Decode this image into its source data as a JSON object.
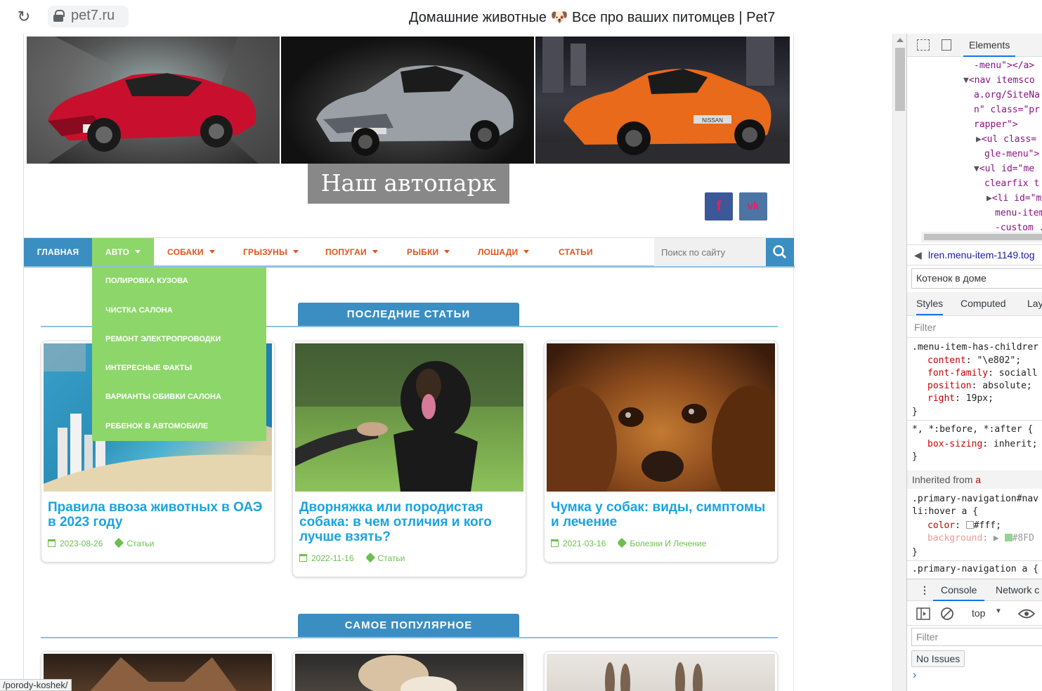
{
  "browser": {
    "url": "pet7.ru",
    "title": "Домашние животные 🐶 Все про ваших питомцев | Pet7"
  },
  "site": {
    "title": "Наш автопарк",
    "nav": {
      "home": "Главная",
      "auto": "Авто",
      "dogs": "Собаки",
      "rodents": "Грызуны",
      "parrots": "Попугаи",
      "fish": "Рыбки",
      "horses": "Лошади",
      "articles": "Статьи",
      "search_placeholder": "Поиск по сайту"
    },
    "dropdown": [
      "Полировка кузова",
      "Чистка салона",
      "Ремонт электропроводки",
      "Интересные факты",
      "Варианты обивки салона",
      "Ребенок в автомобиле"
    ],
    "sections": {
      "latest": "Последние статьи",
      "popular": "Самое популярное"
    },
    "cards": [
      {
        "title": "Правила ввоза животных в ОАЭ в 2023 году",
        "date": "2023-08-26",
        "category": "Статьи"
      },
      {
        "title": "Дворняжка или породистая собака: в чем отличия и кого лучше взять?",
        "date": "2022-11-16",
        "category": "Статьи"
      },
      {
        "title": "Чумка у собак: виды, симптомы и лечение",
        "date": "2021-03-16",
        "category": "Болезни И Лечение"
      }
    ],
    "social": {
      "fb": "f",
      "vk": "vk"
    },
    "status_link": "/porody-koshek/",
    "car_plate": "NISSAN"
  },
  "devtools": {
    "tab_elements": "Elements",
    "dom_lines": [
      "-menu\"></a>",
      "<nav itemsco",
      "a.org/SiteNa",
      "n\" class=\"pr",
      "rapper\">",
      "<ul class=",
      "gle-menu\">",
      "<ul id=\"me",
      "clearfix t",
      "<li id=\"m",
      "menu-item",
      "-custom ."
    ],
    "breadcrumb": "lren.menu-item-1149.tog",
    "find_value": "Котенок в доме",
    "styles_tabs": [
      "Styles",
      "Computed",
      "Lay"
    ],
    "filter": "Filter",
    "css": {
      "rule1_selector": ".menu-item-has-childrer",
      "rule1_props": [
        {
          "name": "content",
          "value": "\"\\e802\";"
        },
        {
          "name": "font-family",
          "value": "sociall"
        },
        {
          "name": "position",
          "value": "absolute;"
        },
        {
          "name": "right",
          "value": "19px;"
        }
      ],
      "close": "}",
      "rule2_selector": "*, *:before, *:after {",
      "rule2_prop": {
        "name": "box-sizing",
        "value": "inherit;"
      },
      "inherited": "Inherited from",
      "inherited_el": "a",
      "rule3_selector_a": ".primary-navigation#nav",
      "rule3_selector_b": "li:hover a {",
      "rule3_color": {
        "name": "color",
        "value": "#fff;"
      },
      "rule3_bg": {
        "name": "background",
        "value": "#8FD"
      },
      "rule4_selector": ".primary-navigation a {"
    },
    "drawer": {
      "console": "Console",
      "network": "Network c",
      "context": "top",
      "filter": "Filter",
      "issues": "No Issues",
      "prompt": "›"
    }
  }
}
